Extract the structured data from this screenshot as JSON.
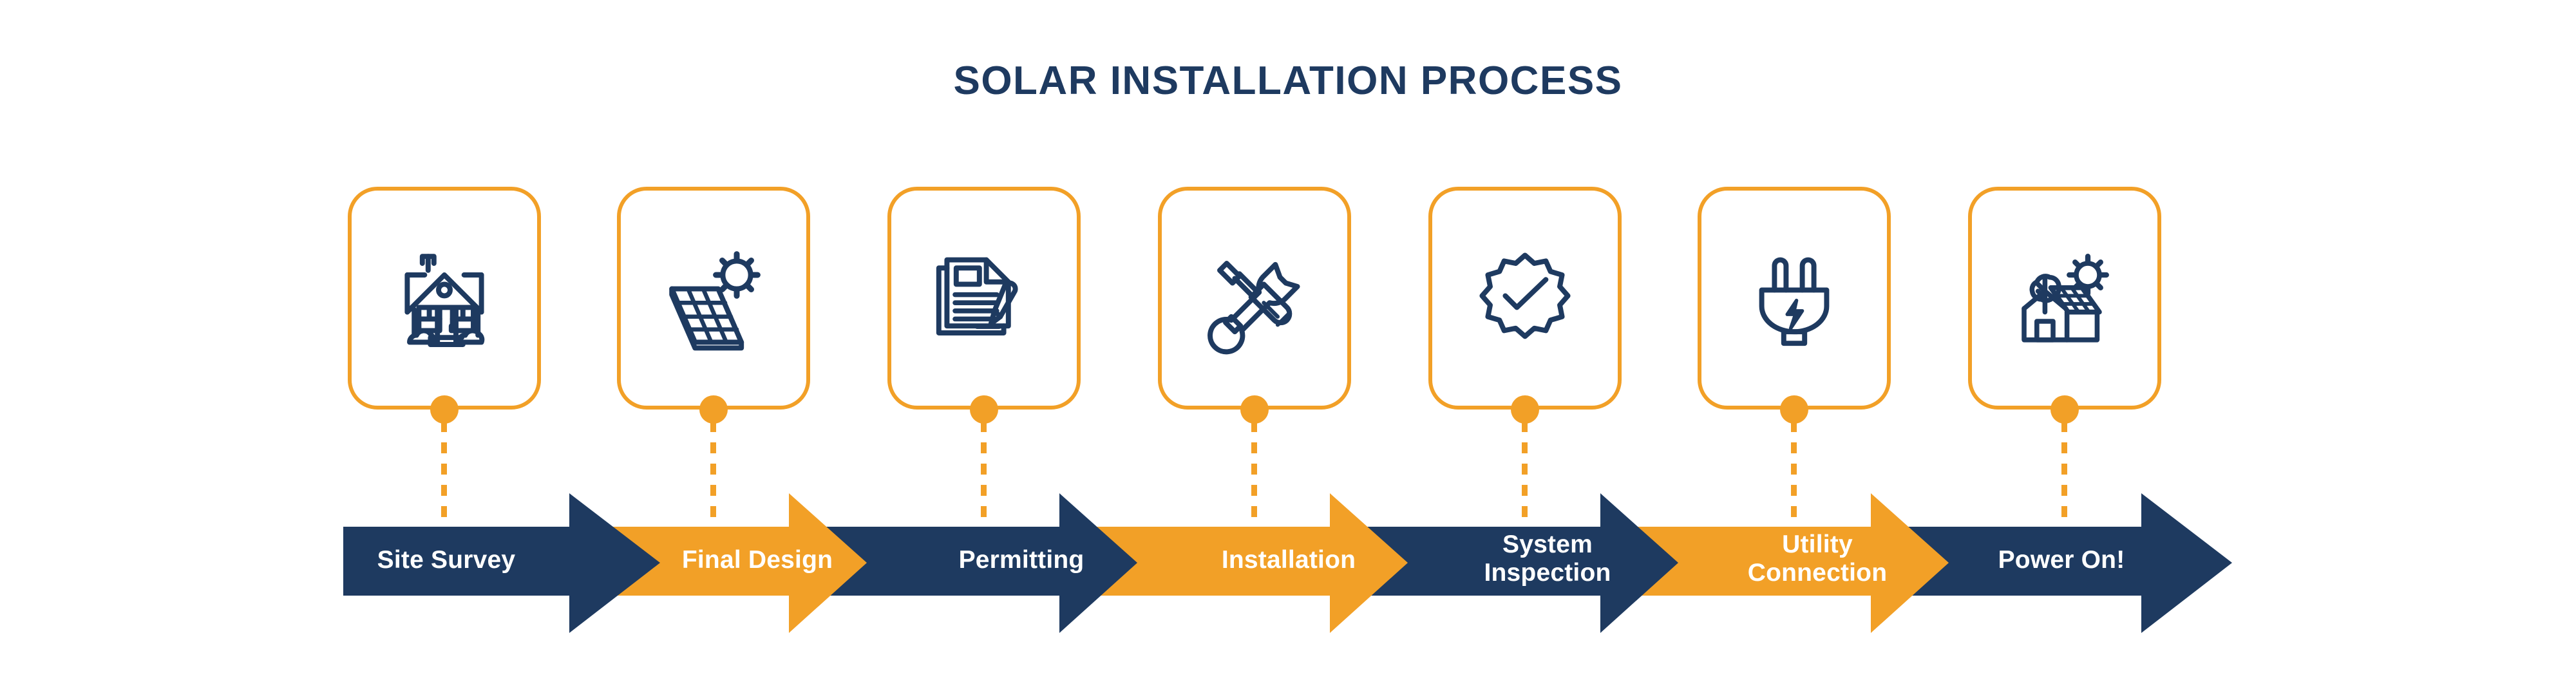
{
  "page": {
    "title": "SOLAR INSTALLATION PROCESS",
    "background_color": "#FFFFFF"
  },
  "colors": {
    "navy": "#1E3A60",
    "orange": "#F2A027",
    "white": "#FFFFFF"
  },
  "steps": [
    {
      "index": 1,
      "label": "Site Survey",
      "icon": "house-icon",
      "arrow_color": "#1E3A60",
      "label_color": "#FFFFFF",
      "card_border_color": "#F2A027",
      "connector_dot_color": "#F2A027"
    },
    {
      "index": 2,
      "label": "Final Design",
      "icon": "solar-panel-sun-icon",
      "arrow_color": "#F2A027",
      "label_color": "#FFFFFF",
      "card_border_color": "#F2A027",
      "connector_dot_color": "#F2A027"
    },
    {
      "index": 3,
      "label": "Permitting",
      "icon": "documents-pen-icon",
      "arrow_color": "#1E3A60",
      "label_color": "#FFFFFF",
      "card_border_color": "#F2A027",
      "connector_dot_color": "#F2A027"
    },
    {
      "index": 4,
      "label": "Installation",
      "icon": "wrench-screwdriver-icon",
      "arrow_color": "#F2A027",
      "label_color": "#FFFFFF",
      "card_border_color": "#F2A027",
      "connector_dot_color": "#F2A027"
    },
    {
      "index": 5,
      "label": "System\nInspection",
      "icon": "badge-check-icon",
      "arrow_color": "#1E3A60",
      "label_color": "#FFFFFF",
      "card_border_color": "#F2A027",
      "connector_dot_color": "#F2A027"
    },
    {
      "index": 6,
      "label": "Utility\nConnection",
      "icon": "power-plug-bolt-icon",
      "arrow_color": "#F2A027",
      "label_color": "#FFFFFF",
      "card_border_color": "#F2A027",
      "connector_dot_color": "#F2A027"
    },
    {
      "index": 7,
      "label": "Power On!",
      "icon": "solar-house-sun-icon",
      "arrow_color": "#1E3A60",
      "label_color": "#FFFFFF",
      "card_border_color": "#F2A027",
      "connector_dot_color": "#F2A027"
    }
  ]
}
